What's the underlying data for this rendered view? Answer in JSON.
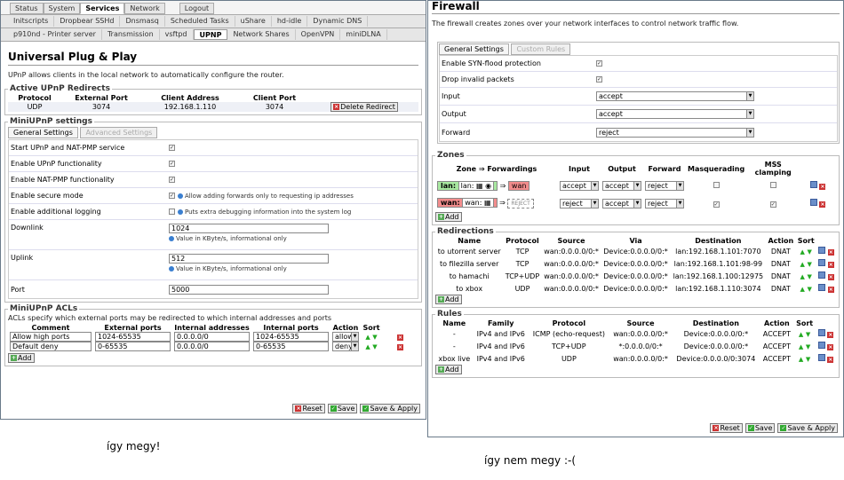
{
  "left": {
    "top_tabs": [
      "Status",
      "System",
      "Services",
      "Network",
      "Logout"
    ],
    "service_tabs_row1": [
      "Initscripts",
      "Dropbear SSHd",
      "Dnsmasq",
      "Scheduled Tasks",
      "uShare",
      "hd-idle",
      "Dynamic DNS"
    ],
    "service_tabs_row2": [
      "p910nd - Printer server",
      "Transmission",
      "vsftpd",
      "UPNP",
      "Network Shares",
      "OpenVPN",
      "miniDLNA"
    ],
    "title": "Universal Plug & Play",
    "description": "UPnP allows clients in the local network to automatically configure the router.",
    "redirects": {
      "legend": "Active UPnP Redirects",
      "headers": [
        "Protocol",
        "External Port",
        "Client Address",
        "Client Port"
      ],
      "rows": [
        [
          "UDP",
          "3074",
          "192.168.1.110",
          "3074"
        ]
      ],
      "delete_label": "Delete Redirect"
    },
    "settings": {
      "legend": "MiniUPnP settings",
      "tab_general": "General Settings",
      "tab_advanced": "Advanced Settings",
      "start_label": "Start UPnP and NAT-PMP service",
      "enable_upnp_label": "Enable UPnP functionality",
      "enable_natpmp_label": "Enable NAT-PMP functionality",
      "secure_label": "Enable secure mode",
      "secure_hint": "Allow adding forwards only to requesting ip addresses",
      "logging_label": "Enable additional logging",
      "logging_hint": "Puts extra debugging information into the system log",
      "downlink_label": "Downlink",
      "downlink_value": "1024",
      "downlink_hint": "Value in KByte/s, informational only",
      "uplink_label": "Uplink",
      "uplink_value": "512",
      "uplink_hint": "Value in KByte/s, informational only",
      "port_label": "Port",
      "port_value": "5000"
    },
    "acls": {
      "legend": "MiniUPnP ACLs",
      "description": "ACLs specify which external ports may be redirected to which internal addresses and ports",
      "headers": [
        "Comment",
        "External ports",
        "Internal addresses",
        "Internal ports",
        "Action",
        "Sort"
      ],
      "rows": [
        {
          "comment": "Allow high ports",
          "ext": "1024-65535",
          "addr": "0.0.0.0/0",
          "int": "1024-65535",
          "action": "allow"
        },
        {
          "comment": "Default deny",
          "ext": "0-65535",
          "addr": "0.0.0.0/0",
          "int": "0-65535",
          "action": "deny"
        }
      ],
      "add_label": "Add"
    },
    "buttons": {
      "reset": "Reset",
      "save": "Save",
      "save_apply": "Save & Apply"
    }
  },
  "right": {
    "title": "Firewall",
    "description": "The firewall creates zones over your network interfaces to control network traffic flow.",
    "tab_general": "General Settings",
    "tab_custom": "Custom Rules",
    "synflood_label": "Enable SYN-flood protection",
    "drop_invalid_label": "Drop invalid packets",
    "input_label": "Input",
    "input_value": "accept",
    "output_label": "Output",
    "output_value": "accept",
    "forward_label": "Forward",
    "forward_value": "reject",
    "zones": {
      "legend": "Zones",
      "headers": [
        "Zone ⇒ Forwardings",
        "Input",
        "Output",
        "Forward",
        "Masquerading",
        "MSS clamping"
      ],
      "rows": [
        {
          "zone": "lan:",
          "iface": "lan:",
          "fwd": "wan",
          "input": "accept",
          "output": "accept",
          "forward": "reject"
        },
        {
          "zone": "wan:",
          "iface": "wan:",
          "fwd": "REJECT",
          "input": "reject",
          "output": "accept",
          "forward": "reject"
        }
      ],
      "add_label": "Add"
    },
    "redirections": {
      "legend": "Redirections",
      "headers": [
        "Name",
        "Protocol",
        "Source",
        "Via",
        "Destination",
        "Action",
        "Sort"
      ],
      "rows": [
        [
          "to utorrent server",
          "TCP",
          "wan:0.0.0.0/0:*",
          "Device:0.0.0.0/0:*",
          "lan:192.168.1.101:7070",
          "DNAT"
        ],
        [
          "to filezilla server",
          "TCP",
          "wan:0.0.0.0/0:*",
          "Device:0.0.0.0/0:*",
          "lan:192.168.1.101:98-99",
          "DNAT"
        ],
        [
          "to hamachi",
          "TCP+UDP",
          "wan:0.0.0.0/0:*",
          "Device:0.0.0.0/0:*",
          "lan:192.168.1.100:12975",
          "DNAT"
        ],
        [
          "to xbox",
          "UDP",
          "wan:0.0.0.0/0:*",
          "Device:0.0.0.0/0:*",
          "lan:192.168.1.110:3074",
          "DNAT"
        ]
      ],
      "add_label": "Add"
    },
    "rules": {
      "legend": "Rules",
      "headers": [
        "Name",
        "Family",
        "Protocol",
        "Source",
        "Destination",
        "Action",
        "Sort"
      ],
      "rows": [
        [
          "-",
          "IPv4 and IPv6",
          "ICMP (echo-request)",
          "wan:0.0.0.0/0:*",
          "Device:0.0.0.0/0:*",
          "ACCEPT"
        ],
        [
          "-",
          "IPv4 and IPv6",
          "TCP+UDP",
          "*:0.0.0.0/0:*",
          "Device:0.0.0.0/0:*",
          "ACCEPT"
        ],
        [
          "xbox live",
          "IPv4 and IPv6",
          "UDP",
          "wan:0.0.0.0/0:*",
          "Device:0.0.0.0/0:3074",
          "ACCEPT"
        ]
      ],
      "add_label": "Add"
    },
    "buttons": {
      "reset": "Reset",
      "save": "Save",
      "save_apply": "Save & Apply"
    }
  },
  "captions": {
    "left": "így megy!",
    "right": "így nem megy :-("
  }
}
